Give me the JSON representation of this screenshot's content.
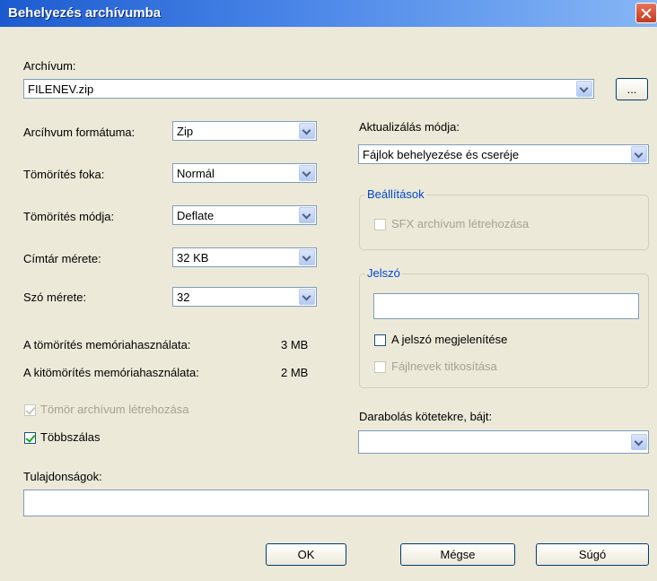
{
  "window": {
    "title": "Behelyezés archívumba"
  },
  "archive": {
    "label": "Archívum:",
    "value": "FILENEV.zip",
    "browse_label": "..."
  },
  "left": {
    "format_label": "Arcíhvum formátuma:",
    "format_value": "Zip",
    "level_label": "Tömörítés foka:",
    "level_value": "Normál",
    "method_label": "Tömörítés módja:",
    "method_value": "Deflate",
    "dict_label": "Címtár mérete:",
    "dict_value": "32 KB",
    "word_label": "Szó mérete:",
    "word_value": "32",
    "mem_comp_label": "A tömörítés memóriahasználata:",
    "mem_comp_value": "3 MB",
    "mem_decomp_label": "A kitömörítés memóriahasználata:",
    "mem_decomp_value": "2 MB",
    "solid_label": "Tömör archívum létrehozása",
    "multithread_label": "Többszálas"
  },
  "right": {
    "update_label": "Aktualizálás módja:",
    "update_value": "Fájlok behelyezése és cseréje",
    "options_title": "Beállítások",
    "sfx_label": "SFX archívum létrehozása",
    "password_title": "Jelszó",
    "show_password_label": "A jelszó megjelenítése",
    "encrypt_names_label": "Fájlnevek titkosítása",
    "split_label": "Darabolás kötetekre, bájt:"
  },
  "properties": {
    "label": "Tulajdonságok:"
  },
  "buttons": {
    "ok": "OK",
    "cancel": "Mégse",
    "help": "Súgó"
  }
}
